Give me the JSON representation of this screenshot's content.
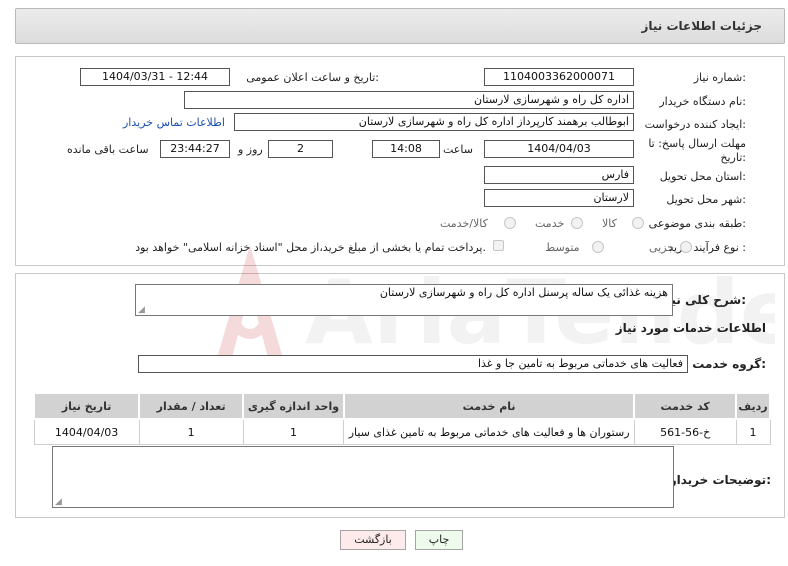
{
  "header": {
    "title": "جزئیات اطلاعات نیاز"
  },
  "details": {
    "need_number_label": "شماره نیاز:",
    "need_number": "1104003362000071",
    "announce_label": "تاریخ و ساعت اعلان عمومی:",
    "announce_value": "1404/03/31 - 12:44",
    "buyer_org_label": "نام دستگاه خریدار:",
    "buyer_org": "اداره کل راه و شهرسازی لارستان",
    "creator_label": "ایجاد کننده درخواست:",
    "creator": "ابوطالب برهمند کارپرداز اداره کل راه و شهرسازی لارستان",
    "contact_link": "اطلاعات تماس خریدار",
    "deadline_label_1": "مهلت ارسال پاسخ: تا",
    "deadline_label_2": "تاریخ:",
    "deadline_date": "1404/04/03",
    "time_label": "ساعت",
    "deadline_time": "14:08",
    "days_value": "2",
    "days_label": "روز و",
    "remaining_time": "23:44:27",
    "remaining_label": "ساعت باقی مانده",
    "province_label": "استان محل تحویل:",
    "province": "فارس",
    "city_label": "شهر محل تحویل:",
    "city": "لارستان",
    "category_label": "طبقه بندی موضوعی:",
    "category_options": [
      "کالا",
      "خدمت",
      "کالا/خدمت"
    ],
    "process_label": "نوع فرآیند خرید :",
    "process_options": [
      "جزیی",
      "متوسط"
    ],
    "payment_note": "پرداخت تمام یا بخشی از مبلغ خرید،از محل \"اسناد خزانه اسلامی\" خواهد بود."
  },
  "summary": {
    "label": "شرح کلی نیاز:",
    "text": "هزینه غذائی یک ساله پرسنل اداره کل راه و شهرسازی لارستان"
  },
  "services": {
    "section_title": "اطلاعات خدمات مورد نیاز",
    "group_label": "گروه خدمت:",
    "group_value": "فعالیت های خدماتی مربوط به تامین جا و غذا",
    "columns": [
      "ردیف",
      "کد خدمت",
      "نام خدمت",
      "واحد اندازه گیری",
      "تعداد / مقدار",
      "تاریخ نیاز"
    ],
    "rows": [
      [
        "1",
        "خ-56-561",
        "رستوران ها و فعالیت های خدماتی مربوط به تامین غذای سیار",
        "1",
        "1",
        "1404/04/03"
      ]
    ]
  },
  "buyer_notes": {
    "label": "توضیحات خریدار:",
    "value": ""
  },
  "buttons": {
    "print": "چاپ",
    "back": "بازگشت"
  },
  "watermark": {
    "text": "AriaTender.net"
  }
}
